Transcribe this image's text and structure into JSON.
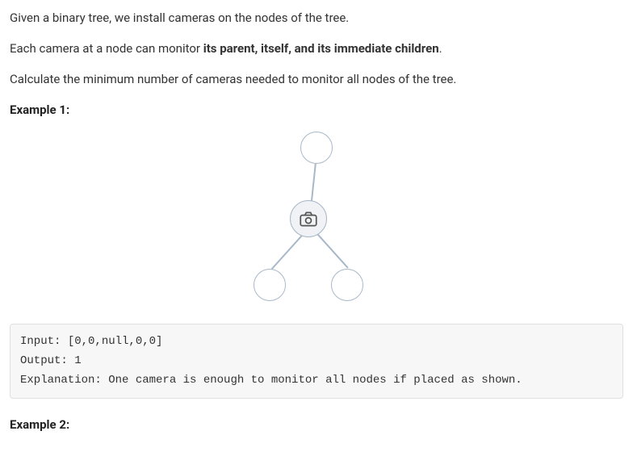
{
  "problem": {
    "intro_line1": "Given a binary tree, we install cameras on the nodes of the tree.",
    "intro_line2_prefix": "Each camera at a node can monitor ",
    "intro_line2_bold": "its parent, itself, and its immediate children",
    "intro_line2_suffix": ".",
    "intro_line3": "Calculate the minimum number of cameras needed to monitor all nodes of the tree."
  },
  "example1": {
    "heading": "Example 1",
    "heading_colon": ":",
    "code": {
      "input_label": "Input: ",
      "input_value": "[0,0,null,0,0]",
      "output_label": "Output: ",
      "output_value": "1",
      "explanation_label": "Explanation: ",
      "explanation_value": "One camera is enough to monitor all nodes if placed as shown."
    }
  },
  "example2": {
    "heading": "Example 2",
    "heading_colon": ":"
  },
  "tree_diagram": {
    "nodes": [
      "root",
      "camera-node",
      "left-leaf",
      "right-leaf"
    ],
    "camera_on": "camera-node"
  }
}
